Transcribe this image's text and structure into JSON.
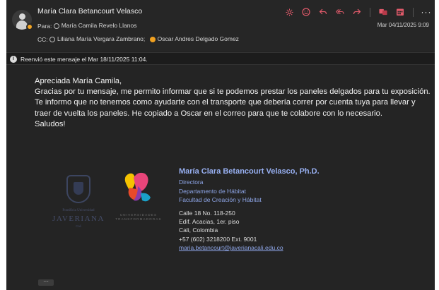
{
  "header": {
    "sender": "María Clara Betancourt Velasco",
    "to_label": "Para:",
    "to": [
      "María Camila Revelo Llanos"
    ],
    "cc_label": "CC:",
    "cc": [
      "Liliana María Vergara Zambrano;",
      "Oscar Andres Delgado Gomez"
    ],
    "date": "Mar 04/11/2025 9:09",
    "actions": [
      "sun-icon",
      "smiley-icon",
      "reply-icon",
      "reply-all-icon",
      "forward-icon",
      "translate-icon",
      "calendar-icon",
      "more-icon"
    ],
    "more_label": "···"
  },
  "resent": {
    "icon": "i",
    "text": "Reenvió este mensaje el Mar 18/11/2025 11:04."
  },
  "body": {
    "greeting": "Apreciada María Camila,",
    "paragraph": "Gracias por tu mensaje, me permito informar que si te podemos prestar los paneles delgados para tu exposición. Te informo que no tenemos como ayudarte con el transporte que debería correr por cuenta tuya para llevar y traer de vuelta los paneles. He copiado a Oscar en el correo para que te colabore con lo necesario.",
    "closing": "Saludos!"
  },
  "signature": {
    "name": "María Clara Betancourt Velasco, Ph.D.",
    "title": "Directora",
    "department": "Departamento de Hábitat",
    "faculty": "Facultad de Creación y Hábitat",
    "address1": "Calle 18 No. 118-250",
    "address2": "Edif. Acacias, 1er. piso",
    "city": "Cali, Colombia",
    "phone": "+57 (602) 3218200 Ext. 9001",
    "email": "maria.betancourt@javerianacali.edu.co"
  },
  "logos": {
    "javeriana_top": "Pontificia Universidad",
    "javeriana_name": "JAVERIANA",
    "javeriana_sub": "Cali",
    "ut_text": "UNIVERSIDADES TRANSFORMADORAS"
  },
  "expand_label": "···",
  "colors": {
    "background": "#242424",
    "accent": "#e05a6a",
    "signature_blue": "#8ea6e8",
    "presence": "#f5a623"
  }
}
